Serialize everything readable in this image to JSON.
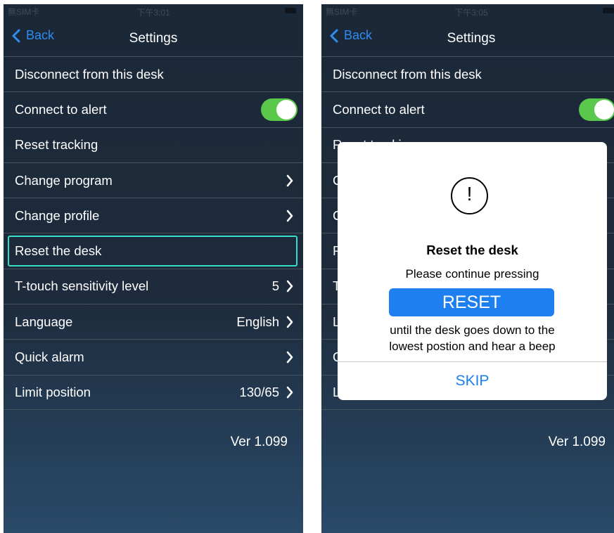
{
  "status_bar": {
    "carrier": "無SIM卡",
    "time_left": "下午3:01",
    "time_right": "下午3:05"
  },
  "nav": {
    "back_label": "Back",
    "title": "Settings"
  },
  "settings": {
    "disconnect": "Disconnect from this desk",
    "connect_alert": "Connect to alert",
    "reset_tracking": "Reset tracking",
    "change_program": "Change program",
    "change_profile": "Change profile",
    "reset_desk": "Reset the desk",
    "sensitivity": {
      "label": "T-touch sensitivity level",
      "value": "5"
    },
    "language": {
      "label": "Language",
      "value": "English"
    },
    "quick_alarm": "Quick alarm",
    "limit_position": {
      "label": "Limit position",
      "value": "130/65"
    }
  },
  "toggle_on": true,
  "version": "Ver 1.099",
  "dialog": {
    "title": "Reset the desk",
    "line1": "Please continue pressing",
    "reset_label": "RESET",
    "line2": "until the desk goes down to the",
    "line3": "lowest postion and hear a beep",
    "skip_label": "SKIP",
    "peek": {
      "reset_tracking": "Reset tracking",
      "c1": "C",
      "c2": "C",
      "r": "R",
      "t": "T",
      "l1": "L",
      "q": "Q",
      "l2": "L"
    }
  },
  "colors": {
    "accent": "#2f8cf0",
    "toggle": "#5ac84a",
    "highlight": "#36dcc6",
    "button": "#1d7ff0"
  }
}
